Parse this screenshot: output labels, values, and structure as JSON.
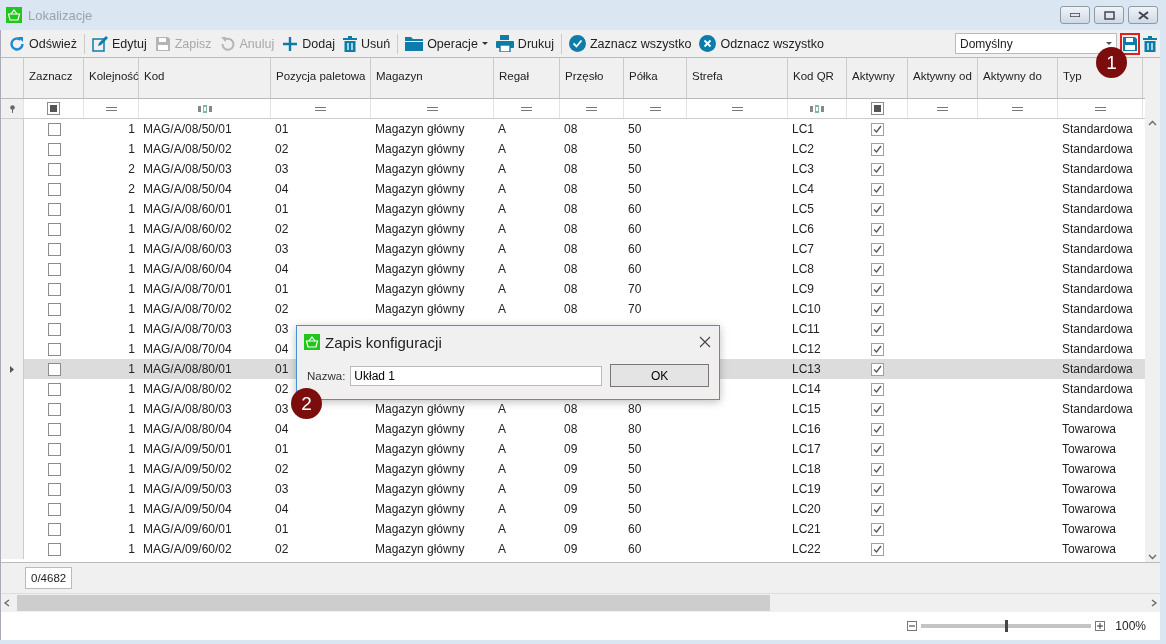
{
  "window": {
    "title": "Lokalizacje"
  },
  "toolbar": [
    {
      "label": "Odśwież",
      "kind": "refresh",
      "disabled": false,
      "dropdown": false,
      "separator_after": true
    },
    {
      "label": "Edytuj",
      "kind": "edit",
      "disabled": false,
      "dropdown": false,
      "separator_after": false
    },
    {
      "label": "Zapisz",
      "kind": "save",
      "disabled": true,
      "dropdown": false,
      "separator_after": false
    },
    {
      "label": "Anuluj",
      "kind": "undo",
      "disabled": true,
      "dropdown": false,
      "separator_after": false
    },
    {
      "label": "Dodaj",
      "kind": "plus",
      "disabled": false,
      "dropdown": false,
      "separator_after": false
    },
    {
      "label": "Usuń",
      "kind": "trash",
      "disabled": false,
      "dropdown": false,
      "separator_after": true
    },
    {
      "label": "Operacje",
      "kind": "folder",
      "disabled": false,
      "dropdown": true,
      "separator_after": false
    },
    {
      "label": "Drukuj",
      "kind": "print",
      "disabled": false,
      "dropdown": false,
      "separator_after": true
    },
    {
      "label": "Zaznacz wszystko",
      "kind": "check",
      "disabled": false,
      "dropdown": false,
      "separator_after": false
    },
    {
      "label": "Odznacz wszystko",
      "kind": "cross",
      "disabled": false,
      "dropdown": false,
      "separator_after": false
    }
  ],
  "layout_select": {
    "value": "Domyślny"
  },
  "layout_actions": [
    {
      "kind": "save",
      "highlighted": true
    },
    {
      "kind": "trash",
      "highlighted": false
    }
  ],
  "columns": [
    {
      "label": "Zaznacz",
      "kind": "check",
      "filter": {
        "kind": "checkbox",
        "indeterminate": true
      }
    },
    {
      "label": "Kolejność",
      "kind": "number",
      "filter": {
        "kind": "equals"
      }
    },
    {
      "label": "Kod",
      "kind": "text",
      "filter": {
        "kind": "text"
      }
    },
    {
      "label": "Pozycja paletowa",
      "kind": "text",
      "filter": {
        "kind": "equals"
      }
    },
    {
      "label": "Magazyn",
      "kind": "text",
      "filter": {
        "kind": "equals"
      }
    },
    {
      "label": "Regał",
      "kind": "text",
      "filter": {
        "kind": "equals"
      }
    },
    {
      "label": "Przęsło",
      "kind": "text",
      "filter": {
        "kind": "equals"
      }
    },
    {
      "label": "Półka",
      "kind": "text",
      "filter": {
        "kind": "equals"
      }
    },
    {
      "label": "Strefa",
      "kind": "text",
      "filter": {
        "kind": "equals"
      }
    },
    {
      "label": "Kod QR",
      "kind": "text",
      "filter": {
        "kind": "text"
      }
    },
    {
      "label": "Aktywny",
      "kind": "check",
      "filter": {
        "kind": "checkbox",
        "indeterminate": true
      }
    },
    {
      "label": "Aktywny od",
      "kind": "text",
      "filter": {
        "kind": "equals"
      }
    },
    {
      "label": "Aktywny do",
      "kind": "text",
      "filter": {
        "kind": "equals"
      }
    },
    {
      "label": "Typ",
      "kind": "text",
      "filter": {
        "kind": "equals"
      }
    }
  ],
  "rows": [
    {
      "selected": false,
      "zaznacz": false,
      "kolejnosc": "1",
      "kod": "MAG/A/08/50/01",
      "pozycja": "01",
      "magazyn": "Magazyn główny",
      "regal": "A",
      "przeslo": "08",
      "polka": "50",
      "kod_qr": "LC1",
      "aktywny": true,
      "typ": "Standardowa"
    },
    {
      "selected": false,
      "zaznacz": false,
      "kolejnosc": "1",
      "kod": "MAG/A/08/50/02",
      "pozycja": "02",
      "magazyn": "Magazyn główny",
      "regal": "A",
      "przeslo": "08",
      "polka": "50",
      "kod_qr": "LC2",
      "aktywny": true,
      "typ": "Standardowa"
    },
    {
      "selected": false,
      "zaznacz": false,
      "kolejnosc": "2",
      "kod": "MAG/A/08/50/03",
      "pozycja": "03",
      "magazyn": "Magazyn główny",
      "regal": "A",
      "przeslo": "08",
      "polka": "50",
      "kod_qr": "LC3",
      "aktywny": true,
      "typ": "Standardowa"
    },
    {
      "selected": false,
      "zaznacz": false,
      "kolejnosc": "2",
      "kod": "MAG/A/08/50/04",
      "pozycja": "04",
      "magazyn": "Magazyn główny",
      "regal": "A",
      "przeslo": "08",
      "polka": "50",
      "kod_qr": "LC4",
      "aktywny": true,
      "typ": "Standardowa"
    },
    {
      "selected": false,
      "zaznacz": false,
      "kolejnosc": "1",
      "kod": "MAG/A/08/60/01",
      "pozycja": "01",
      "magazyn": "Magazyn główny",
      "regal": "A",
      "przeslo": "08",
      "polka": "60",
      "kod_qr": "LC5",
      "aktywny": true,
      "typ": "Standardowa"
    },
    {
      "selected": false,
      "zaznacz": false,
      "kolejnosc": "1",
      "kod": "MAG/A/08/60/02",
      "pozycja": "02",
      "magazyn": "Magazyn główny",
      "regal": "A",
      "przeslo": "08",
      "polka": "60",
      "kod_qr": "LC6",
      "aktywny": true,
      "typ": "Standardowa"
    },
    {
      "selected": false,
      "zaznacz": false,
      "kolejnosc": "1",
      "kod": "MAG/A/08/60/03",
      "pozycja": "03",
      "magazyn": "Magazyn główny",
      "regal": "A",
      "przeslo": "08",
      "polka": "60",
      "kod_qr": "LC7",
      "aktywny": true,
      "typ": "Standardowa"
    },
    {
      "selected": false,
      "zaznacz": false,
      "kolejnosc": "1",
      "kod": "MAG/A/08/60/04",
      "pozycja": "04",
      "magazyn": "Magazyn główny",
      "regal": "A",
      "przeslo": "08",
      "polka": "60",
      "kod_qr": "LC8",
      "aktywny": true,
      "typ": "Standardowa"
    },
    {
      "selected": false,
      "zaznacz": false,
      "kolejnosc": "1",
      "kod": "MAG/A/08/70/01",
      "pozycja": "01",
      "magazyn": "Magazyn główny",
      "regal": "A",
      "przeslo": "08",
      "polka": "70",
      "kod_qr": "LC9",
      "aktywny": true,
      "typ": "Standardowa"
    },
    {
      "selected": false,
      "zaznacz": false,
      "kolejnosc": "1",
      "kod": "MAG/A/08/70/02",
      "pozycja": "02",
      "magazyn": "Magazyn główny",
      "regal": "A",
      "przeslo": "08",
      "polka": "70",
      "kod_qr": "LC10",
      "aktywny": true,
      "typ": "Standardowa"
    },
    {
      "selected": false,
      "zaznacz": false,
      "kolejnosc": "1",
      "kod": "MAG/A/08/70/03",
      "pozycja": "03",
      "kod_qr": "LC11",
      "aktywny": true,
      "typ": "Standardowa"
    },
    {
      "selected": false,
      "zaznacz": false,
      "kolejnosc": "1",
      "kod": "MAG/A/08/70/04",
      "pozycja": "04",
      "kod_qr": "LC12",
      "aktywny": true,
      "typ": "Standardowa"
    },
    {
      "selected": true,
      "zaznacz": false,
      "kolejnosc": "1",
      "kod": "MAG/A/08/80/01",
      "pozycja": "01",
      "kod_qr": "LC13",
      "aktywny": true,
      "typ": "Standardowa"
    },
    {
      "selected": false,
      "zaznacz": false,
      "kolejnosc": "1",
      "kod": "MAG/A/08/80/02",
      "pozycja": "02",
      "kod_qr": "LC14",
      "aktywny": true,
      "typ": "Standardowa"
    },
    {
      "selected": false,
      "zaznacz": false,
      "kolejnosc": "1",
      "kod": "MAG/A/08/80/03",
      "pozycja": "03",
      "magazyn": "Magazyn główny",
      "regal": "A",
      "przeslo": "08",
      "polka": "80",
      "kod_qr": "LC15",
      "aktywny": true,
      "typ": "Standardowa"
    },
    {
      "selected": false,
      "zaznacz": false,
      "kolejnosc": "1",
      "kod": "MAG/A/08/80/04",
      "pozycja": "04",
      "magazyn": "Magazyn główny",
      "regal": "A",
      "przeslo": "08",
      "polka": "80",
      "kod_qr": "LC16",
      "aktywny": true,
      "typ": "Towarowa"
    },
    {
      "selected": false,
      "zaznacz": false,
      "kolejnosc": "1",
      "kod": "MAG/A/09/50/01",
      "pozycja": "01",
      "magazyn": "Magazyn główny",
      "regal": "A",
      "przeslo": "09",
      "polka": "50",
      "kod_qr": "LC17",
      "aktywny": true,
      "typ": "Towarowa"
    },
    {
      "selected": false,
      "zaznacz": false,
      "kolejnosc": "1",
      "kod": "MAG/A/09/50/02",
      "pozycja": "02",
      "magazyn": "Magazyn główny",
      "regal": "A",
      "przeslo": "09",
      "polka": "50",
      "kod_qr": "LC18",
      "aktywny": true,
      "typ": "Towarowa"
    },
    {
      "selected": false,
      "zaznacz": false,
      "kolejnosc": "1",
      "kod": "MAG/A/09/50/03",
      "pozycja": "03",
      "magazyn": "Magazyn główny",
      "regal": "A",
      "przeslo": "09",
      "polka": "50",
      "kod_qr": "LC19",
      "aktywny": true,
      "typ": "Towarowa"
    },
    {
      "selected": false,
      "zaznacz": false,
      "kolejnosc": "1",
      "kod": "MAG/A/09/50/04",
      "pozycja": "04",
      "magazyn": "Magazyn główny",
      "regal": "A",
      "przeslo": "09",
      "polka": "50",
      "kod_qr": "LC20",
      "aktywny": true,
      "typ": "Towarowa"
    },
    {
      "selected": false,
      "zaznacz": false,
      "kolejnosc": "1",
      "kod": "MAG/A/09/60/01",
      "pozycja": "01",
      "magazyn": "Magazyn główny",
      "regal": "A",
      "przeslo": "09",
      "polka": "60",
      "kod_qr": "LC21",
      "aktywny": true,
      "typ": "Towarowa"
    },
    {
      "selected": false,
      "zaznacz": false,
      "kolejnosc": "1",
      "kod": "MAG/A/09/60/02",
      "pozycja": "02",
      "magazyn": "Magazyn główny",
      "regal": "A",
      "przeslo": "09",
      "polka": "60",
      "kod_qr": "LC22",
      "aktywny": true,
      "typ": "Towarowa"
    }
  ],
  "record_count": "0/4682",
  "zoom": {
    "level": 0.5,
    "reading": "100%"
  },
  "dialog": {
    "title": "Zapis konfiguracji",
    "label": "Nazwa:",
    "value": "Układ 1",
    "button": "OK"
  },
  "markers": [
    {
      "number": "1"
    },
    {
      "number": "2"
    }
  ]
}
